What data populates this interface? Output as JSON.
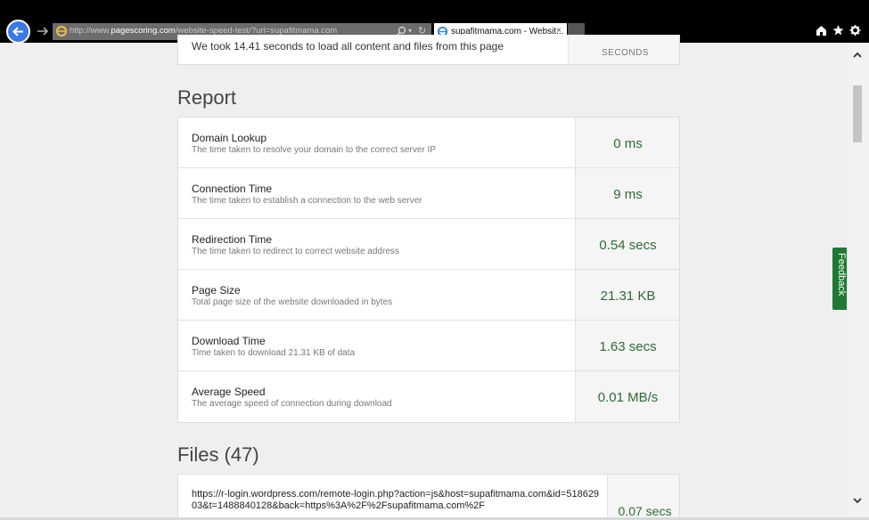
{
  "browser": {
    "url_prefix": "http://www.",
    "url_domain": "pagescoring.com",
    "url_path": "/website-speed-test/?url=supafitmama.com",
    "tab_title": "supafitmama.com - Websit...",
    "tab_close": "×"
  },
  "summary": {
    "message": "We took 14.41 seconds to load all content and files from this page",
    "unit": "SECONDS"
  },
  "report": {
    "title": "Report",
    "rows": [
      {
        "label": "Domain Lookup",
        "desc": "The time taken to resolve your domain to the correct server IP",
        "value": "0 ms"
      },
      {
        "label": "Connection Time",
        "desc": "The time taken to establish a connection to the web server",
        "value": "9 ms"
      },
      {
        "label": "Redirection Time",
        "desc": "The time taken to redirect to correct website address",
        "value": "0.54 secs"
      },
      {
        "label": "Page Size",
        "desc": "Total page size of the website downloaded in bytes",
        "value": "21.31 KB"
      },
      {
        "label": "Download Time",
        "desc": "Time taken to download 21.31 KB of data",
        "value": "1.63 secs"
      },
      {
        "label": "Average Speed",
        "desc": "The average speed of connection during download",
        "value": "0.01 MB/s"
      }
    ]
  },
  "files": {
    "title": "Files (47)",
    "first_url": "https://r-login.wordpress.com/remote-login.php?action=js&host=supafitmama.com&id=51862903&t=1488840128&back=https%3A%2F%2Fsupafitmama.com%2F",
    "first_value": "0.07 secs"
  },
  "feedback_label": "Feedback",
  "colors": {
    "accent": "#2e6b35",
    "feedback": "#1e7a32",
    "back_button": "#3b78e7"
  },
  "icons": [
    "back-arrow-icon",
    "forward-arrow-icon",
    "ie-icon",
    "search-icon",
    "refresh-icon",
    "home-icon",
    "star-icon",
    "gear-icon",
    "chevron-up-icon",
    "chevron-down-icon"
  ]
}
